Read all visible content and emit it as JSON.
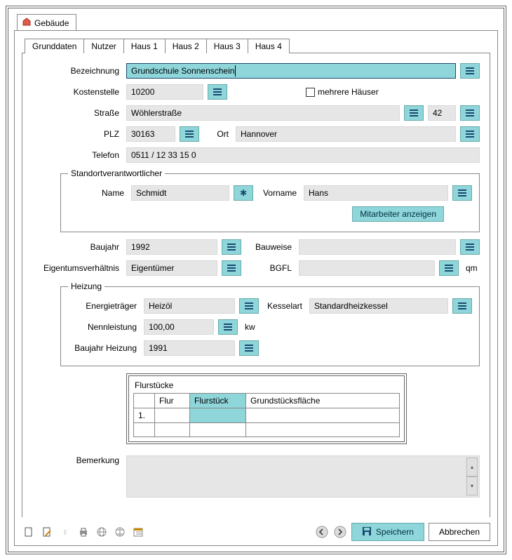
{
  "window": {
    "title": "Gebäude"
  },
  "tabs": [
    "Grunddaten",
    "Nutzer",
    "Haus 1",
    "Haus 2",
    "Haus 3",
    "Haus 4"
  ],
  "labels": {
    "bezeichnung": "Bezeichnung",
    "kostenstelle": "Kostenstelle",
    "mehrere_haeuser": "mehrere Häuser",
    "strasse": "Straße",
    "plz": "PLZ",
    "ort": "Ort",
    "telefon": "Telefon",
    "standort_group": "Standortverantwortlicher",
    "name": "Name",
    "vorname": "Vorname",
    "mitarbeiter_btn": "Mitarbeiter anzeigen",
    "baujahr": "Baujahr",
    "bauweise": "Bauweise",
    "eigentum": "Eigentumsverhältnis",
    "bgfl": "BGFL",
    "qm": "qm",
    "heizung_group": "Heizung",
    "energietraeger": "Energieträger",
    "kesselart": "Kesselart",
    "nennleistung": "Nennleistung",
    "kw": "kw",
    "baujahr_heizung": "Baujahr Heizung",
    "flurstuecke": "Flurstücke",
    "bemerkung": "Bemerkung"
  },
  "fields": {
    "bezeichnung": "Grundschule Sonnenschein",
    "kostenstelle": "10200",
    "strasse": "Wöhlerstraße",
    "hausnr": "42",
    "plz": "30163",
    "ort": "Hannover",
    "telefon": "0511 / 12 33 15 0",
    "name": "Schmidt",
    "vorname": "Hans",
    "baujahr": "1992",
    "bauweise": "",
    "eigentum": "Eigentümer",
    "bgfl": "",
    "energietraeger": "Heizöl",
    "kesselart": "Standardheizkessel",
    "nennleistung": "100,00",
    "baujahr_heizung": "1991",
    "bemerkung": ""
  },
  "flur_table": {
    "headers": [
      "",
      "Flur",
      "Flurstück",
      "Grundstücksfläche"
    ],
    "selected_header_index": 2,
    "rows": [
      {
        "num": "1.",
        "flur": "",
        "flurstueck": "",
        "flaeche": ""
      },
      {
        "num": "",
        "flur": "",
        "flurstueck": "",
        "flaeche": ""
      }
    ]
  },
  "footer": {
    "save": "Speichern",
    "cancel": "Abbrechen"
  }
}
